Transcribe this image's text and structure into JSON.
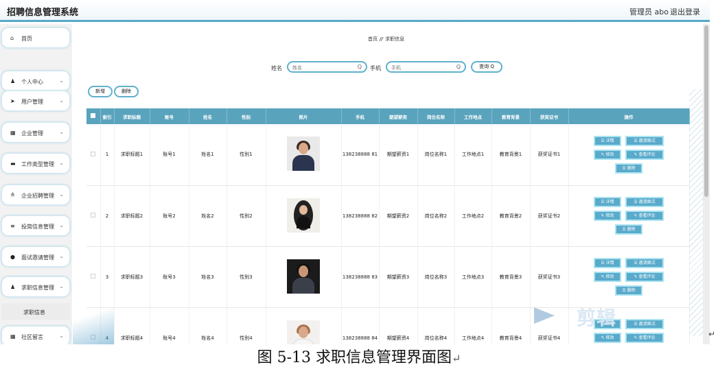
{
  "header": {
    "app_title": "招聘信息管理系统",
    "admin_label": "管理员 abo",
    "logout_label": "退出登录"
  },
  "sidebar": {
    "items": [
      {
        "icon": "home-icon",
        "glyph": "⌂",
        "label": "首页",
        "chevron": false
      },
      {
        "icon": "user-icon",
        "glyph": "♟",
        "label": "个人中心",
        "chevron": true
      },
      {
        "icon": "send-icon",
        "glyph": "➤",
        "label": "用户管理",
        "chevron": true
      },
      {
        "icon": "grid-icon",
        "glyph": "▦",
        "label": "企业管理",
        "chevron": true
      },
      {
        "icon": "briefcase-icon",
        "glyph": "▬",
        "label": "工作类型管理",
        "chevron": true
      },
      {
        "icon": "list-icon",
        "glyph": "≙",
        "label": "企业招聘管理",
        "chevron": true
      },
      {
        "icon": "menu-icon",
        "glyph": "≡",
        "label": "投简信息管理",
        "chevron": true
      },
      {
        "icon": "pin-icon",
        "glyph": "●",
        "label": "面试邀请管理",
        "chevron": true
      },
      {
        "icon": "user-icon",
        "glyph": "♟",
        "label": "求职信息管理",
        "chevron": true
      },
      {
        "icon": "grid-icon",
        "glyph": "▦",
        "label": "社区留言",
        "chevron": true
      }
    ],
    "sub_item": "求职信息",
    "chevron_glyph": "⌄"
  },
  "breadcrumb": {
    "home": "首页",
    "separator": "//",
    "current": "求职信息"
  },
  "search": {
    "name_label": "姓名",
    "name_placeholder": "姓名",
    "phone_label": "手机",
    "phone_placeholder": "手机",
    "query_button": "查询 Q",
    "mag_glyph": "Q"
  },
  "actions": {
    "add": "新增",
    "delete": "删除"
  },
  "table": {
    "columns": [
      "索引",
      "求职标题",
      "账号",
      "姓名",
      "性别",
      "照片",
      "手机",
      "期望薪资",
      "岗位名称",
      "工作地点",
      "教育背景",
      "获奖证书",
      "操作"
    ],
    "rows": [
      {
        "index": "1",
        "title": "求职标题1",
        "account": "账号1",
        "name": "姓名1",
        "gender": "性别1",
        "phone": "138238888 81",
        "salary": "期望薪资1",
        "position": "岗位名称1",
        "location": "工作地点1",
        "education": "教育背景1",
        "award": "获奖证书1"
      },
      {
        "index": "2",
        "title": "求职标题2",
        "account": "账号2",
        "name": "姓名2",
        "gender": "性别2",
        "phone": "138238888 82",
        "salary": "期望薪资2",
        "position": "岗位名称2",
        "location": "工作地点2",
        "education": "教育背景2",
        "award": "获奖证书2"
      },
      {
        "index": "3",
        "title": "求职标题3",
        "account": "账号3",
        "name": "姓名3",
        "gender": "性别3",
        "phone": "138238888 83",
        "salary": "期望薪资3",
        "position": "岗位名称3",
        "location": "工作地点3",
        "education": "教育背景3",
        "award": "获奖证书3"
      },
      {
        "index": "4",
        "title": "求职标题4",
        "account": "账号4",
        "name": "姓名4",
        "gender": "性别4",
        "phone": "138238888 84",
        "salary": "期望薪资4",
        "position": "岗位名称4",
        "location": "工作地点4",
        "education": "教育背景4",
        "award": "获奖证书4"
      }
    ],
    "row_actions": {
      "detail": "☰ 详情",
      "interview": "☰ 邀请面试",
      "edit": "✎ 修改",
      "review": "✎ 查看评论",
      "remove": "☰ 删除"
    }
  },
  "watermark": "剪辑",
  "caption": "图 5-13 求职信息管理界面图",
  "colors": {
    "accent": "#5aa3bd",
    "button_border": "#5eb0cc",
    "op_button": "#59aacb"
  }
}
